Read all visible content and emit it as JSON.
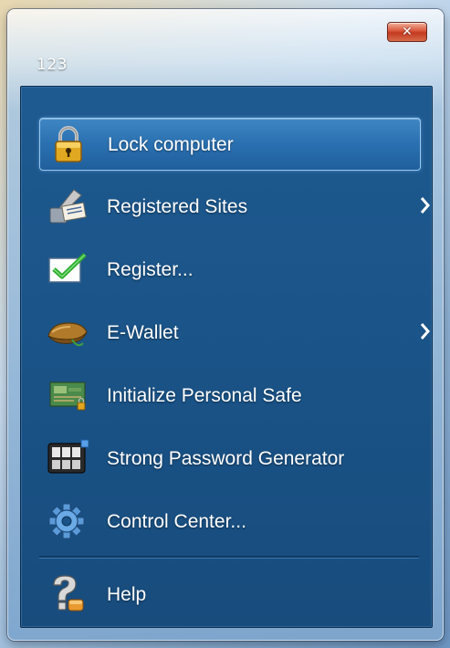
{
  "window": {
    "user_name": "123",
    "close_symbol": "✕"
  },
  "menu": {
    "items": [
      {
        "label": "Lock computer",
        "icon": "padlock-icon",
        "selected": true,
        "submenu": false
      },
      {
        "label": "Registered Sites",
        "icon": "registered-sites-icon",
        "selected": false,
        "submenu": true
      },
      {
        "label": "Register...",
        "icon": "checkmark-icon",
        "selected": false,
        "submenu": false
      },
      {
        "label": "E-Wallet",
        "icon": "wallet-icon",
        "selected": false,
        "submenu": true
      },
      {
        "label": "Initialize Personal Safe",
        "icon": "personal-safe-icon",
        "selected": false,
        "submenu": false
      },
      {
        "label": "Strong Password Generator",
        "icon": "password-generator-icon",
        "selected": false,
        "submenu": false
      },
      {
        "label": "Control Center...",
        "icon": "gear-icon",
        "selected": false,
        "submenu": false
      },
      {
        "label": "Help",
        "icon": "help-icon",
        "selected": false,
        "submenu": false
      }
    ]
  },
  "colors": {
    "panel_bg": "#1a5387",
    "selection": "#2a70b0",
    "close_button": "#c23a20",
    "text": "#ffffff"
  }
}
